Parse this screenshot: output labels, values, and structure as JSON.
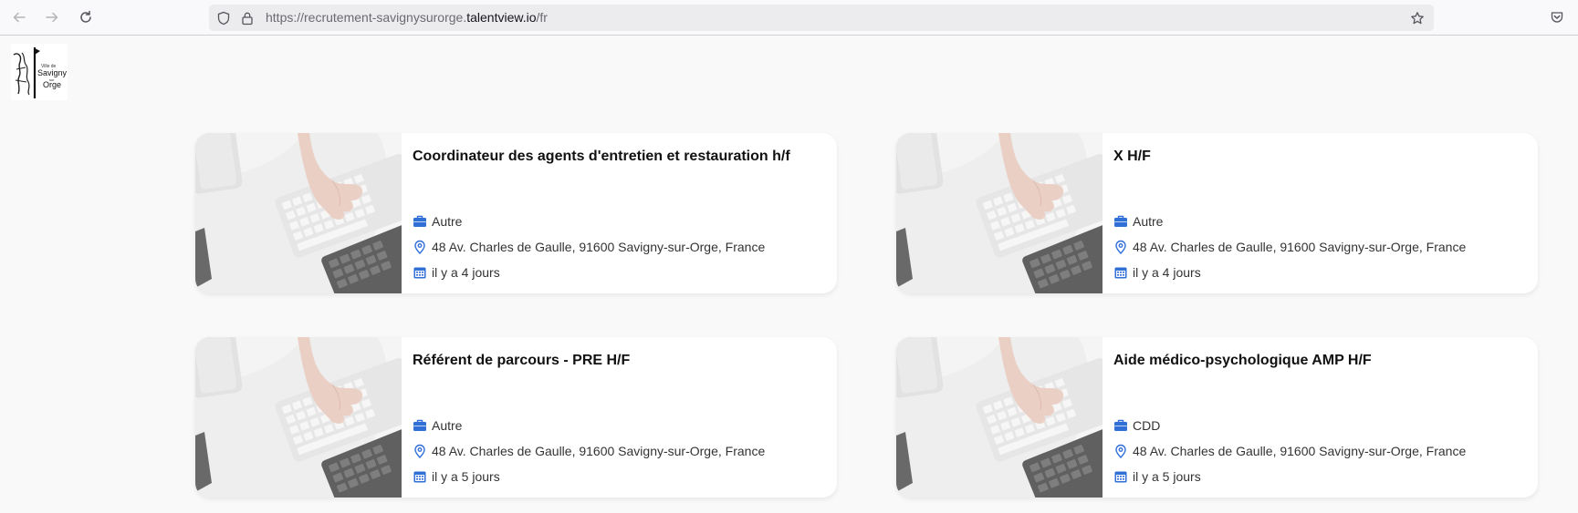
{
  "browser": {
    "url_prefix": "https://recrutement-savignysurorge.",
    "url_domain": "talentview.io",
    "url_suffix": "/fr"
  },
  "logo": {
    "line1": "Ville de",
    "line2": "Savigny",
    "line3": "sur",
    "line4": "Orge"
  },
  "jobs": [
    {
      "title": "Coordinateur des agents d'entretien et restauration h/f",
      "contract": "Autre",
      "location": "48 Av. Charles de Gaulle, 91600 Savigny-sur-Orge, France",
      "posted": "il y a 4 jours"
    },
    {
      "title": "X H/F",
      "contract": "Autre",
      "location": "48 Av. Charles de Gaulle, 91600 Savigny-sur-Orge, France",
      "posted": "il y a 4 jours"
    },
    {
      "title": "Référent de parcours - PRE H/F",
      "contract": "Autre",
      "location": "48 Av. Charles de Gaulle, 91600 Savigny-sur-Orge, France",
      "posted": "il y a 5 jours"
    },
    {
      "title": "Aide médico-psychologique AMP H/F",
      "contract": "CDD",
      "location": "48 Av. Charles de Gaulle, 91600 Savigny-sur-Orge, France",
      "posted": "il y a 5 jours"
    }
  ],
  "colors": {
    "icon_blue": "#2f6fd6",
    "page_bg": "#f9f9f9"
  },
  "icons": {
    "contract": "briefcase-icon",
    "location": "map-pin-icon",
    "posted": "calendar-icon"
  }
}
